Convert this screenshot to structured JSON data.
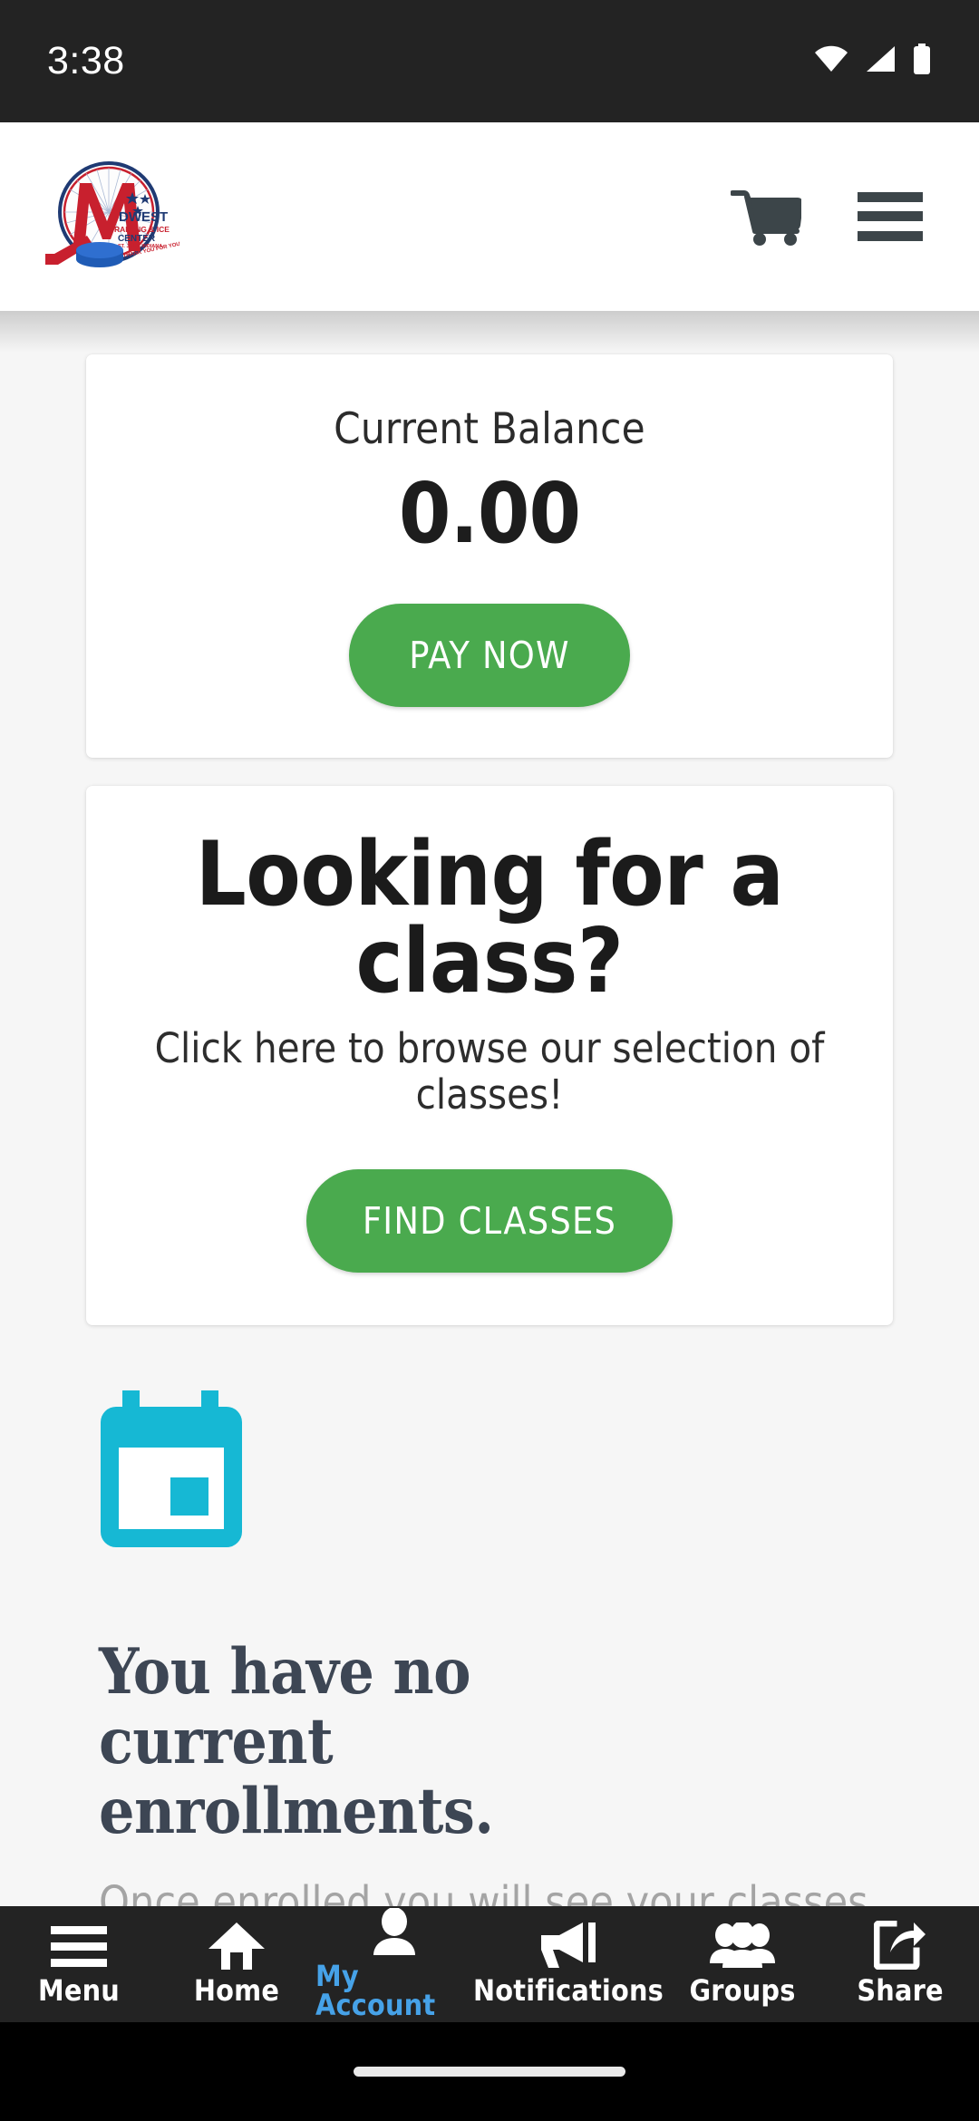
{
  "status_bar": {
    "time": "3:38",
    "icons": [
      "wifi-icon",
      "cellular-signal-icon",
      "battery-icon"
    ]
  },
  "header": {
    "logo_alt": "MIDWEST TRAINING & ICE CENTER ST. JOHN INDIANA",
    "logo_text_main": "MIDWEST",
    "logo_text_sub": "TRAINING & ICE",
    "logo_text_sub2": "CENTER",
    "logo_text_sub3": "ST. JOHN INDIANA",
    "logo_ribbon": "THANK YOU FOR YOUR SUPPORT",
    "cart_icon": "shopping-cart-icon",
    "menu_icon": "hamburger-menu-icon"
  },
  "balance_card": {
    "label": "Current Balance",
    "amount": "0.00",
    "pay_button": "PAY NOW"
  },
  "class_card": {
    "title": "Looking for a class?",
    "subtitle": "Click here to browse our selection of classes!",
    "find_button": "FIND CLASSES"
  },
  "enrollments": {
    "icon": "calendar-icon",
    "title": "You have no current enrollments.",
    "subtitle": "Once enrolled you will see your classes and"
  },
  "bottom_nav": {
    "items": [
      {
        "label": "Menu",
        "icon": "hamburger-menu-icon",
        "active": false
      },
      {
        "label": "Home",
        "icon": "home-icon",
        "active": false
      },
      {
        "label": "My Account",
        "icon": "user-person-icon",
        "active": true
      },
      {
        "label": "Notifications",
        "icon": "megaphone-icon",
        "active": false
      },
      {
        "label": "Groups",
        "icon": "people-group-icon",
        "active": false
      },
      {
        "label": "Share",
        "icon": "share-icon",
        "active": false
      }
    ]
  },
  "colors": {
    "status_bar_bg": "#232323",
    "page_bg": "#f6f6f6",
    "card_bg": "#ffffff",
    "accent_green": "#4aaa4e",
    "accent_blue": "#46a2e8",
    "calendar_cyan": "#16b8d4",
    "heading_slate": "#3d4654",
    "muted_gray": "#a4a4a4",
    "logo_red": "#c8202e",
    "logo_navy": "#1f3a73"
  }
}
